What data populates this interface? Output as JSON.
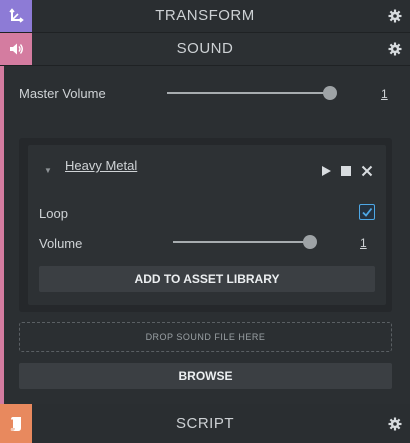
{
  "panels": {
    "transform": {
      "title": "TRANSFORM",
      "badge_icon": "transform-axes-icon",
      "badge_color": "#8d7bd6"
    },
    "sound": {
      "title": "SOUND",
      "badge_icon": "speaker-icon",
      "badge_color": "#d47ca0"
    },
    "script": {
      "title": "SCRIPT",
      "badge_icon": "script-document-icon",
      "badge_color": "#e8895e"
    }
  },
  "sound": {
    "master_volume_label": "Master Volume",
    "master_volume_value": "1",
    "slot": {
      "name": "Heavy Metal",
      "loop_label": "Loop",
      "loop_checked": true,
      "volume_label": "Volume",
      "volume_value": "1",
      "add_to_library_label": "ADD TO ASSET LIBRARY"
    },
    "drop_zone_label": "DROP SOUND FILE HERE",
    "browse_label": "BROWSE"
  },
  "colors": {
    "accent_blue": "#4ea8e6",
    "panel_bg": "#2b2f32"
  }
}
